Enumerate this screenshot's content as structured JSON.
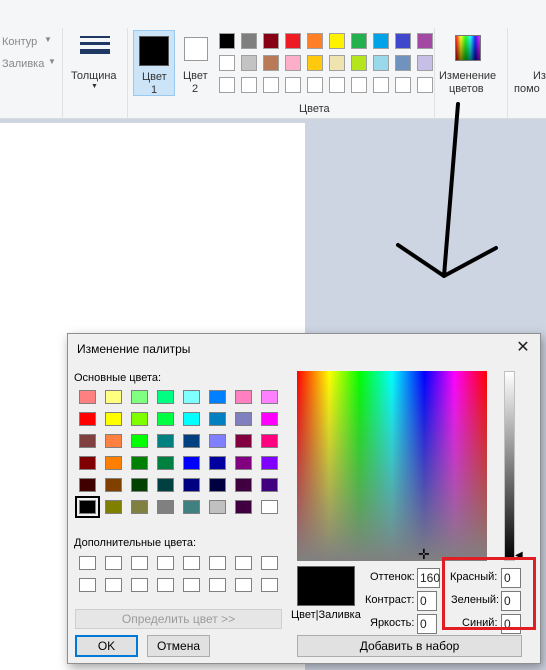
{
  "ribbon": {
    "contour_label": "Контур",
    "fill_label": "Заливка",
    "thickness_label": "Толщина",
    "color1_label_line1": "Цвет",
    "color1_label_line2": "1",
    "color2_label_line1": "Цвет",
    "color2_label_line2": "2",
    "colors_group_label": "Цвета",
    "edit_colors_line1": "Изменение",
    "edit_colors_line2": "цветов",
    "cut_label_line1": "Из",
    "cut_label_line2": "помо",
    "palette_row1": [
      "#000000",
      "#7f7f7f",
      "#880015",
      "#ed1c24",
      "#ff7f27",
      "#fff200",
      "#22b14c",
      "#00a2e8",
      "#3f48cc",
      "#a349a4"
    ],
    "palette_row2": [
      "#ffffff",
      "#c3c3c3",
      "#b97a57",
      "#ffaec9",
      "#ffc90e",
      "#efe4b0",
      "#b5e61d",
      "#99d9ea",
      "#7092be",
      "#c8bfe7"
    ],
    "color1": "#000000",
    "color2": "#ffffff"
  },
  "dialog": {
    "title": "Изменение палитры",
    "basic_colors_label": "Основные цвета:",
    "custom_colors_label": "Дополнительные цвета:",
    "basic_colors": [
      [
        "#ff8080",
        "#ffff80",
        "#80ff80",
        "#00ff80",
        "#80ffff",
        "#0080ff",
        "#ff80c0",
        "#ff80ff"
      ],
      [
        "#ff0000",
        "#ffff00",
        "#80ff00",
        "#00ff40",
        "#00ffff",
        "#0080c0",
        "#8080c0",
        "#ff00ff"
      ],
      [
        "#804040",
        "#ff8040",
        "#00ff00",
        "#008080",
        "#004080",
        "#8080ff",
        "#800040",
        "#ff0080"
      ],
      [
        "#800000",
        "#ff8000",
        "#008000",
        "#008040",
        "#0000ff",
        "#0000a0",
        "#800080",
        "#8000ff"
      ],
      [
        "#400000",
        "#804000",
        "#004000",
        "#004040",
        "#000080",
        "#000040",
        "#400040",
        "#400080"
      ],
      [
        "#000000",
        "#808000",
        "#808040",
        "#808080",
        "#408080",
        "#c0c0c0",
        "#400040",
        "#ffffff"
      ]
    ],
    "define_button": "Определить цвет >>",
    "ok_button": "OK",
    "cancel_button": "Отмена",
    "color_solid_label": "Цвет|Заливка",
    "hue_label": "Оттенок:",
    "hue_value": "160",
    "sat_label": "Контраст:",
    "sat_value": "0",
    "lum_label": "Яркость:",
    "lum_value": "0",
    "red_label": "Красный:",
    "red_value": "0",
    "green_label": "Зеленый:",
    "green_value": "0",
    "blue_label": "Синий:",
    "blue_value": "0",
    "add_button": "Добавить в набор",
    "preview_color": "#000000",
    "highlight_color": "#e21e24"
  },
  "icons": [
    "thickness-icon",
    "edit-colors-icon",
    "close-icon",
    "arrow-annotation"
  ]
}
